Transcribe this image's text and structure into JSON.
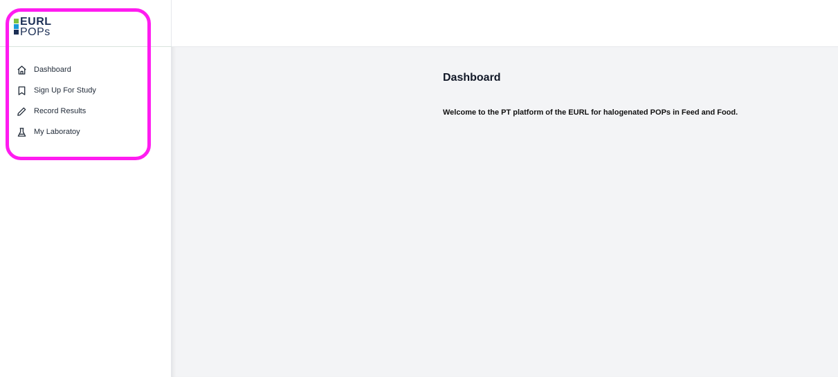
{
  "logo": {
    "line1": "EURL",
    "line2": "POPs",
    "colors": [
      "#7cc242",
      "#1b9ad6",
      "#1c2f55"
    ]
  },
  "sidebar": {
    "items": [
      {
        "label": "Dashboard",
        "icon": "home-icon"
      },
      {
        "label": "Sign Up For Study",
        "icon": "bookmark-icon"
      },
      {
        "label": "Record Results",
        "icon": "pencil-icon"
      },
      {
        "label": "My Laboratoy",
        "icon": "flask-icon"
      }
    ]
  },
  "main": {
    "title": "Dashboard",
    "welcome": "Welcome to the PT platform of the EURL for halogenated POPs in Feed and Food."
  },
  "colors": {
    "highlight": "#ff1cf0",
    "main_background": "#f3f4f6",
    "brand_dark": "#1c2f55"
  }
}
